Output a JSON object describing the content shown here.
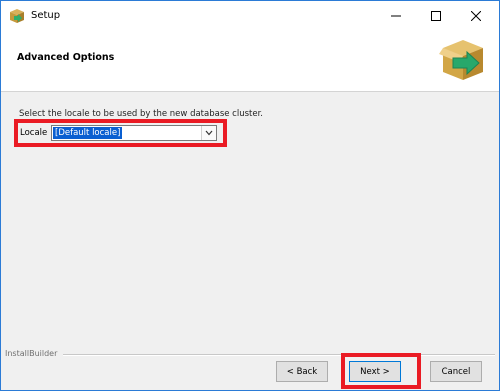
{
  "window": {
    "title": "Setup",
    "controls": {
      "minimize": "minimize-icon",
      "maximize": "maximize-icon",
      "close": "close-icon"
    }
  },
  "header": {
    "title": "Advanced Options",
    "icon": "installer-box-arrow-icon"
  },
  "main": {
    "instruction": "Select the locale to be used by the new database cluster.",
    "locale_label": "Locale",
    "locale_value": "[Default locale]"
  },
  "footer": {
    "brand": "InstallBuilder",
    "back_label": "< Back",
    "next_label": "Next >",
    "cancel_label": "Cancel"
  },
  "colors": {
    "highlight": "#ea1b24",
    "selection": "#0a5fd1",
    "window_border": "#2b7bd6"
  }
}
